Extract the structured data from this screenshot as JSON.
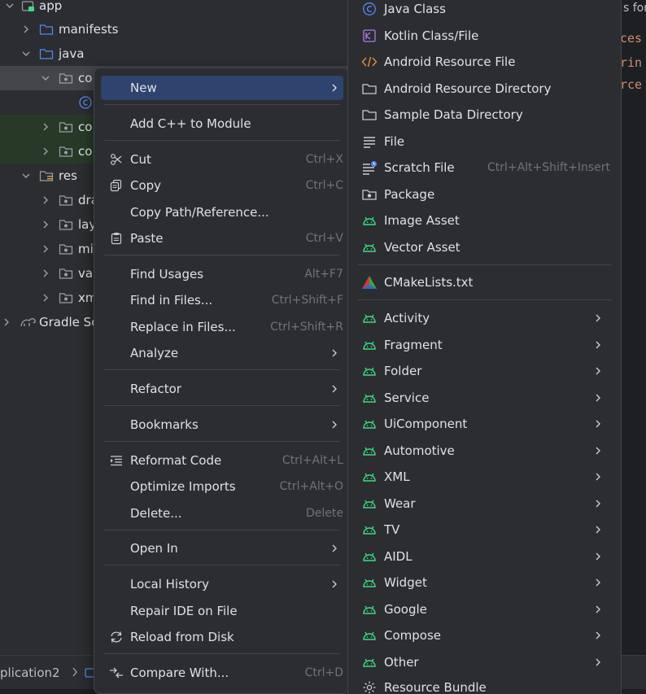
{
  "tree": {
    "items": [
      {
        "label": "app"
      },
      {
        "label": "manifests"
      },
      {
        "label": "java"
      },
      {
        "label": "co"
      },
      {
        "label": ""
      },
      {
        "label": "co"
      },
      {
        "label": "co"
      },
      {
        "label": "res"
      },
      {
        "label": "dra"
      },
      {
        "label": "lay"
      },
      {
        "label": "mi"
      },
      {
        "label": "val"
      },
      {
        "label": "xm"
      },
      {
        "label": "Gradle Sc"
      }
    ]
  },
  "editor": {
    "title_fragment": "s for",
    "code_lines": [
      "ces",
      "rin",
      "rce"
    ]
  },
  "status_bar": {
    "breadcrumb": "plication2"
  },
  "context_menu": {
    "new": "New",
    "add_cpp": "Add C++ to Module",
    "cut": "Cut",
    "cut_key": "Ctrl+X",
    "copy": "Copy",
    "copy_key": "Ctrl+C",
    "copy_path": "Copy Path/Reference...",
    "paste": "Paste",
    "paste_key": "Ctrl+V",
    "find_usages": "Find Usages",
    "find_usages_key": "Alt+F7",
    "find_in_files": "Find in Files...",
    "find_in_files_key": "Ctrl+Shift+F",
    "replace_in_files": "Replace in Files...",
    "replace_in_files_key": "Ctrl+Shift+R",
    "analyze": "Analyze",
    "refactor": "Refactor",
    "bookmarks": "Bookmarks",
    "reformat": "Reformat Code",
    "reformat_key": "Ctrl+Alt+L",
    "optimize": "Optimize Imports",
    "optimize_key": "Ctrl+Alt+O",
    "delete": "Delete...",
    "delete_key": "Delete",
    "open_in": "Open In",
    "local_history": "Local History",
    "repair": "Repair IDE on File",
    "reload": "Reload from Disk",
    "compare": "Compare With...",
    "compare_key": "Ctrl+D"
  },
  "new_submenu": {
    "java_class": "Java Class",
    "kotlin_class": "Kotlin Class/File",
    "android_resource_file": "Android Resource File",
    "android_resource_directory": "Android Resource Directory",
    "sample_data_directory": "Sample Data Directory",
    "file": "File",
    "scratch_file": "Scratch File",
    "scratch_file_key": "Ctrl+Alt+Shift+Insert",
    "package": "Package",
    "image_asset": "Image Asset",
    "vector_asset": "Vector Asset",
    "cmake": "CMakeLists.txt",
    "activity": "Activity",
    "fragment": "Fragment",
    "folder": "Folder",
    "service": "Service",
    "uicomponent": "UiComponent",
    "automotive": "Automotive",
    "xml": "XML",
    "wear": "Wear",
    "tv": "TV",
    "aidl": "AIDL",
    "widget": "Widget",
    "google": "Google",
    "compose": "Compose",
    "other": "Other",
    "resource_bundle": "Resource Bundle"
  },
  "colors": {
    "highlight": "#2e436e",
    "android_green": "#3ddc84",
    "folder_blue": "#548af7",
    "muted": "#6f737a"
  }
}
